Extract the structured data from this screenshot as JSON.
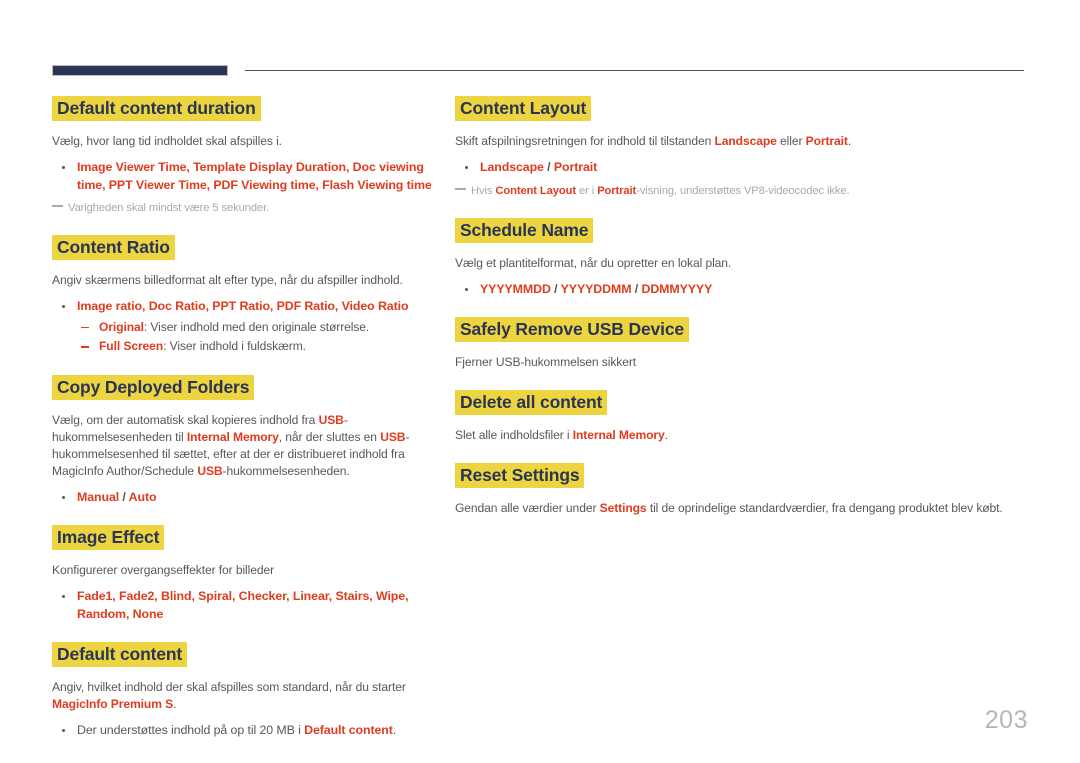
{
  "document": {
    "page_number": "203",
    "accent_navy": "#2b3553",
    "highlight_yellow": "#ecd540",
    "keyword_red": "#e03c1f",
    "body_gray": "#58585a",
    "note_gray": "#a8a9ad"
  },
  "left_column": {
    "sections": [
      {
        "title": "Default content duration",
        "intro": "Vælg, hvor lang tid indholdet skal afspilles i.",
        "bullet": "Image Viewer Time, Template Display Duration, Doc viewing time, PPT Viewer Time, PDF Viewing time, Flash Viewing time",
        "note": "Varigheden skal mindst være 5 sekunder."
      },
      {
        "title": "Content Ratio",
        "intro": "Angiv skærmens billedformat alt efter type, når du afspiller indhold.",
        "bullet": "Image ratio, Doc Ratio, PPT Ratio, PDF Ratio, Video Ratio",
        "sub": [
          {
            "key": "Original",
            "text": ": Viser indhold med den originale størrelse."
          },
          {
            "key": "Full Screen",
            "text": ": Viser indhold i fuldskærm."
          }
        ]
      },
      {
        "title": "Copy Deployed Folders",
        "para_1": "Vælg, om der automatisk skal kopieres indhold fra ",
        "k_usb_1": "USB",
        "para_2": "-hukommelsesenheden til ",
        "k_internal": "Internal Memory",
        "para_3": ", når der sluttes en ",
        "k_usb_2": "USB",
        "para_4": "-hukommelsesenhed til sættet, efter at der er distribueret indhold fra MagicInfo Author/Schedule ",
        "k_usb_3": "USB",
        "para_5": "-hukommelsesenheden.",
        "bullet_a": "Manual",
        "bullet_sep": " / ",
        "bullet_b": "Auto"
      },
      {
        "title": "Image Effect",
        "intro": "Konfigurerer overgangseffekter for billeder",
        "bullet": "Fade1, Fade2, Blind, Spiral, Checker, Linear, Stairs, Wipe, Random, None"
      },
      {
        "title": "Default content",
        "para_1": "Angiv, hvilket indhold der skal afspilles som standard, når du starter ",
        "k_magicinfo": "MagicInfo Premium S",
        "para_2": ".",
        "bullet_pre": "Der understøttes indhold på op til 20 MB i ",
        "bullet_key": "Default content",
        "bullet_post": "."
      }
    ]
  },
  "right_column": {
    "sections": [
      {
        "title": "Content Layout",
        "para_1": "Skift afspilningsretningen for indhold til tilstanden ",
        "k_landscape": "Landscape",
        "para_2": " eller ",
        "k_portrait": "Portrait",
        "para_3": ".",
        "bullet_a": "Landscape",
        "bullet_sep": " / ",
        "bullet_b": "Portrait",
        "note_1": "Hvis ",
        "note_k1": "Content Layout",
        "note_2": " er i ",
        "note_k2": "Portrait",
        "note_3": "-visning, understøttes VP8-videocodec ikke."
      },
      {
        "title": "Schedule Name",
        "intro": "Vælg et plantitelformat, når du opretter en lokal plan.",
        "bullet_a": "YYYYMMDD",
        "bullet_sep1": " / ",
        "bullet_b": "YYYYDDMM",
        "bullet_sep2": " / ",
        "bullet_c": "DDMMYYYY"
      },
      {
        "title": "Safely Remove USB Device",
        "intro": "Fjerner USB-hukommelsen sikkert"
      },
      {
        "title": "Delete all content",
        "para_1": "Slet alle indholdsfiler i ",
        "k_internal": "Internal Memory",
        "para_2": "."
      },
      {
        "title": "Reset Settings",
        "para_1": "Gendan alle værdier under ",
        "k_settings": "Settings",
        "para_2": " til de oprindelige standardværdier, fra dengang produktet blev købt."
      }
    ]
  }
}
